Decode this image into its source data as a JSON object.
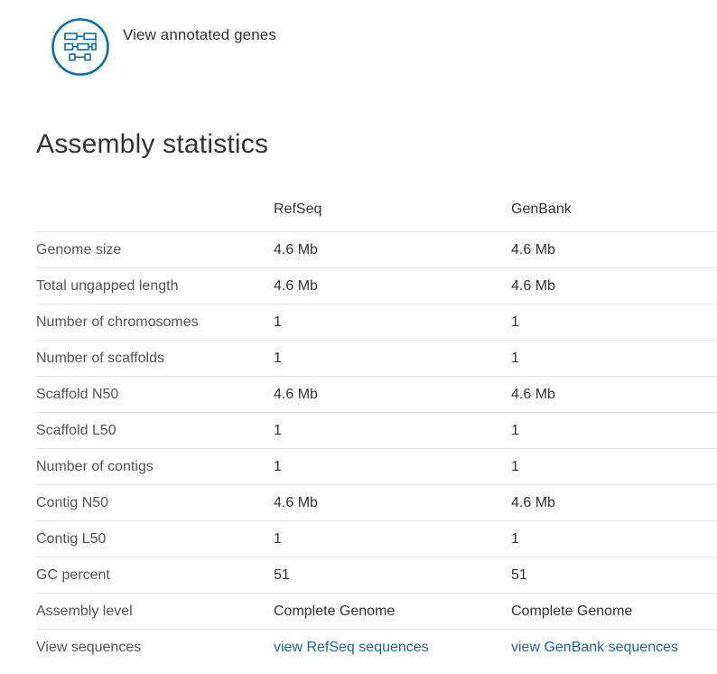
{
  "annotation": {
    "icon": "annotated-genes-icon",
    "label": "View annotated genes",
    "accent": "#0b6db0"
  },
  "section": {
    "title": "Assembly statistics"
  },
  "stats_table": {
    "headers": [
      "",
      "RefSeq",
      "GenBank"
    ],
    "rows": [
      {
        "label": "Genome size",
        "refseq": "4.6 Mb",
        "genbank": "4.6 Mb"
      },
      {
        "label": "Total ungapped length",
        "refseq": "4.6 Mb",
        "genbank": "4.6 Mb"
      },
      {
        "label": "Number of chromosomes",
        "refseq": "1",
        "genbank": "1"
      },
      {
        "label": "Number of scaffolds",
        "refseq": "1",
        "genbank": "1"
      },
      {
        "label": "Scaffold N50",
        "refseq": "4.6 Mb",
        "genbank": "4.6 Mb"
      },
      {
        "label": "Scaffold L50",
        "refseq": "1",
        "genbank": "1"
      },
      {
        "label": "Number of contigs",
        "refseq": "1",
        "genbank": "1"
      },
      {
        "label": "Contig N50",
        "refseq": "4.6 Mb",
        "genbank": "4.6 Mb"
      },
      {
        "label": "Contig L50",
        "refseq": "1",
        "genbank": "1"
      },
      {
        "label": "GC percent",
        "refseq": "51",
        "genbank": "51"
      },
      {
        "label": "Assembly level",
        "refseq": "Complete Genome",
        "genbank": "Complete Genome"
      },
      {
        "label": "View sequences",
        "refseq": "view RefSeq sequences",
        "genbank": "view GenBank sequences"
      }
    ]
  },
  "colors": {
    "link": "#1d64a6",
    "text": "#333333",
    "divider": "#e3e3e3"
  }
}
